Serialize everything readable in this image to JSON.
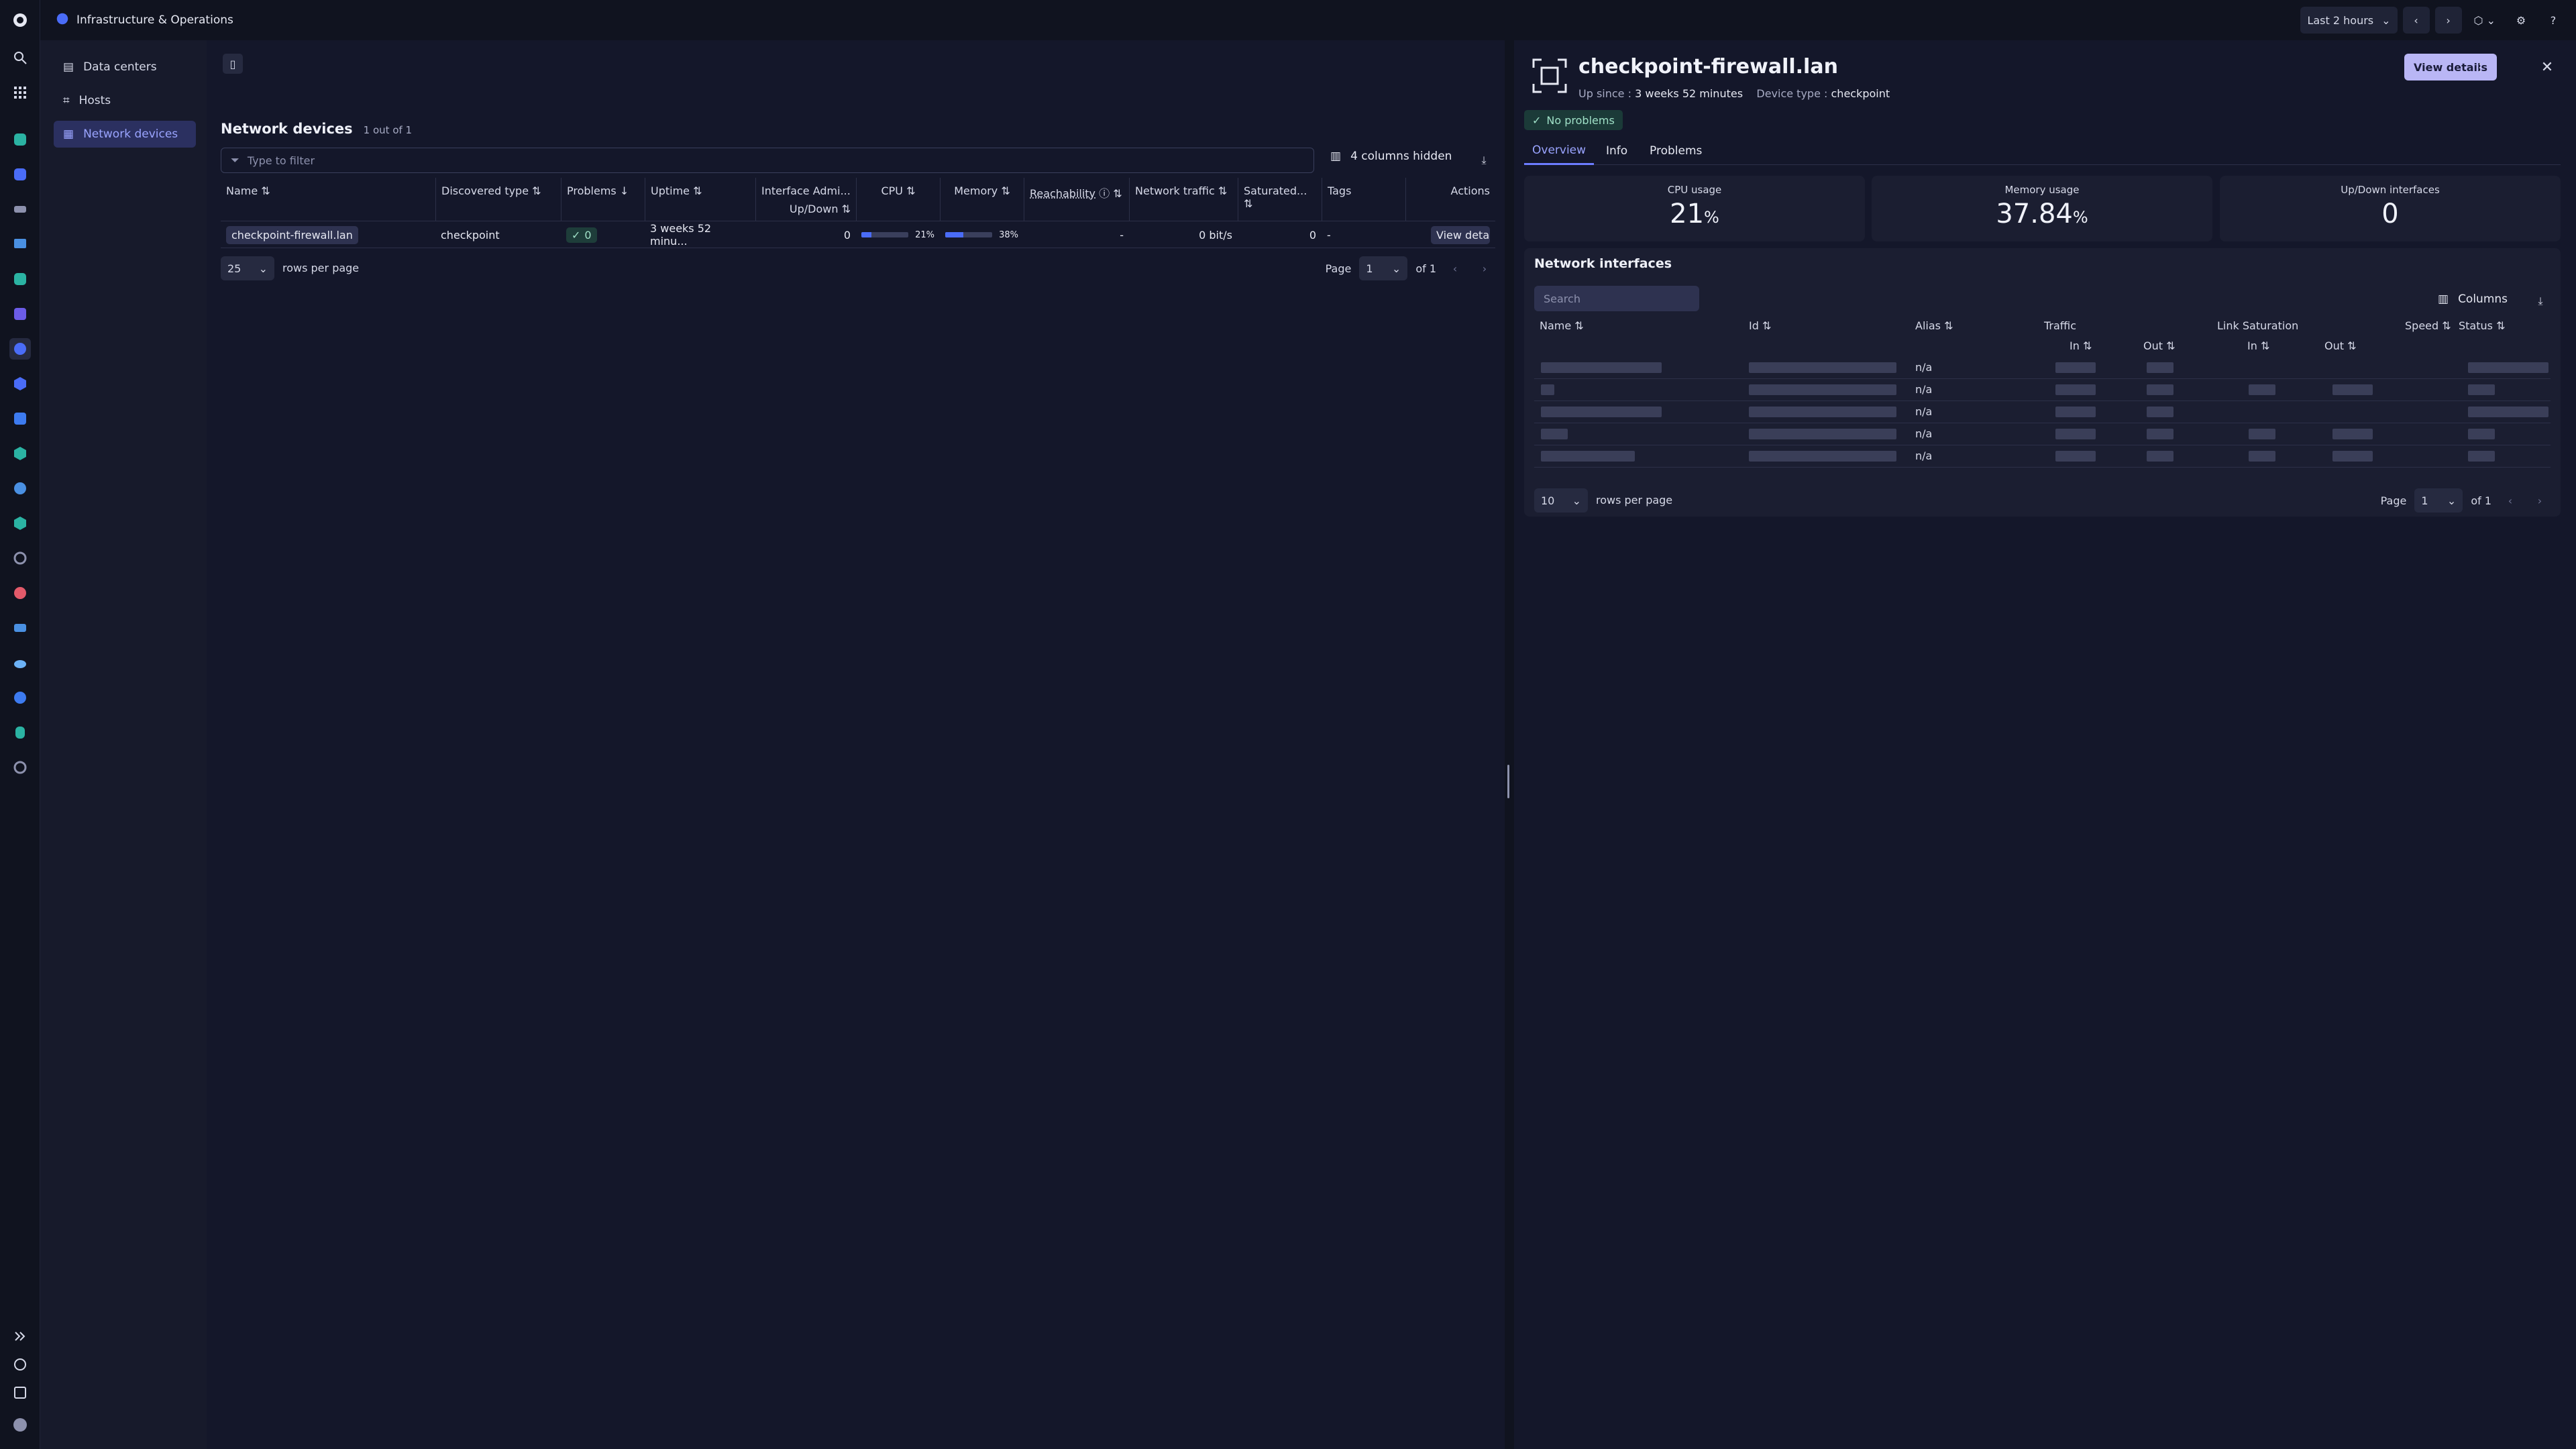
{
  "app": {
    "breadcrumb": "Infrastructure & Operations"
  },
  "topbar": {
    "timeframe_label": "Last 2 hours"
  },
  "sidebar": {
    "items": [
      {
        "label": "Data centers"
      },
      {
        "label": "Hosts"
      },
      {
        "label": "Network devices",
        "active": true
      }
    ]
  },
  "list": {
    "title": "Network devices",
    "count": "1 out of 1",
    "filter_placeholder": "Type to filter",
    "hidden_columns_label": "4 columns hidden",
    "columns": [
      "Name",
      "Discovered type",
      "Problems",
      "Uptime",
      "Interface Admi...",
      "Up/Down",
      "CPU",
      "Memory",
      "Reachability",
      "Network traffic",
      "Saturated...",
      "Tags",
      "Actions"
    ],
    "rows": [
      {
        "name": "checkpoint-firewall.lan",
        "type": "checkpoint",
        "problems": "0",
        "uptime": "3 weeks 52 minu...",
        "interfaces": "0",
        "cpu_label": "21%",
        "cpu_fraction": 0.21,
        "memory_label": "38%",
        "memory_fraction": 0.38,
        "reachability": "-",
        "traffic": "0 bit/s",
        "saturated": "0",
        "tags": "-",
        "action": "View details"
      }
    ],
    "rows_per_page": "25",
    "rows_per_page_label": "rows per page",
    "page_label": "Page",
    "page": "1",
    "page_of": "of 1"
  },
  "detail": {
    "title": "checkpoint-firewall.lan",
    "up_since_label": "Up since :",
    "up_since": "3 weeks 52 minutes",
    "device_type_label": "Device type :",
    "device_type": "checkpoint",
    "view_details_label": "View details",
    "status": "No problems",
    "tabs": [
      "Overview",
      "Info",
      "Problems"
    ],
    "metrics": [
      {
        "label": "CPU usage",
        "value": "21",
        "unit": "%"
      },
      {
        "label": "Memory usage",
        "value": "37.84",
        "unit": "%"
      },
      {
        "label": "Up/Down interfaces",
        "value": "0",
        "unit": ""
      }
    ],
    "interfaces": {
      "title": "Network interfaces",
      "search_placeholder": "Search",
      "columns_label": "Columns",
      "headers": {
        "name": "Name",
        "id": "Id",
        "alias": "Alias",
        "traffic": "Traffic",
        "in": "In",
        "out": "Out",
        "link_saturation": "Link Saturation",
        "speed": "Speed",
        "status": "Status"
      },
      "rows": [
        {
          "alias": "n/a"
        },
        {
          "alias": "n/a"
        },
        {
          "alias": "n/a"
        },
        {
          "alias": "n/a"
        },
        {
          "alias": "n/a"
        }
      ],
      "rows_per_page": "10",
      "rows_per_page_label": "rows per page",
      "page_label": "Page",
      "page": "1",
      "page_of": "of 1"
    }
  },
  "colors": {
    "accent": "#6c7cff",
    "success": "#9fe0c7",
    "primary_button": "#b9b6f5"
  }
}
